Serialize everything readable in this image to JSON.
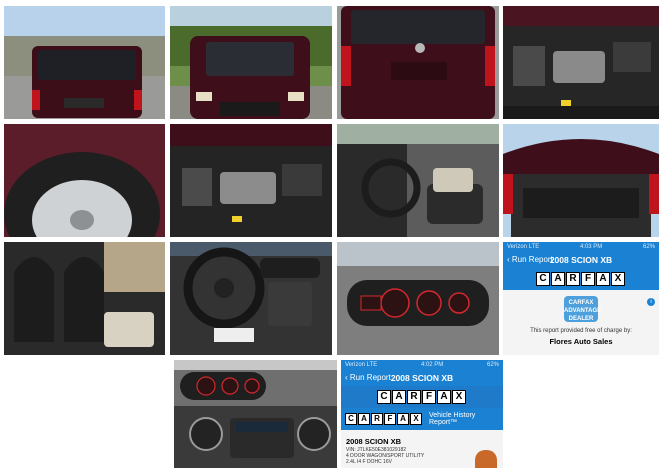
{
  "gallery": {
    "photos": [
      {
        "alt": "rear-view"
      },
      {
        "alt": "front-view"
      },
      {
        "alt": "rear-closeup"
      },
      {
        "alt": "engine-bay"
      },
      {
        "alt": "tire"
      },
      {
        "alt": "engine-bay-2"
      },
      {
        "alt": "driver-interior"
      },
      {
        "alt": "open-hatch"
      },
      {
        "alt": "rear-seats"
      },
      {
        "alt": "steering-wheel"
      },
      {
        "alt": "instrument-cluster"
      },
      {
        "alt": "center-console"
      }
    ]
  },
  "carfax_screen_1": {
    "status_left": "Verizon  LTE",
    "status_time": "4:03 PM",
    "status_right": "62%",
    "back_label": "Run Report",
    "title": "2008 SCION XB",
    "logo_letters": [
      "C",
      "A",
      "R",
      "F",
      "A",
      "X"
    ],
    "badge_text": "CARFAX ADVANTAGE DEALER",
    "provided_text": "This report provided free of charge by:",
    "dealer_name": "Flores Auto Sales",
    "info_icon": "i"
  },
  "carfax_screen_2": {
    "status_left": "Verizon  LTE",
    "status_time": "4:02 PM",
    "status_right": "62%",
    "back_label": "Run Report",
    "title": "2008 SCION XB",
    "logo_letters": [
      "C",
      "A",
      "R",
      "F",
      "A",
      "X"
    ],
    "vhr_label": "Vehicle History Report™",
    "model": "2008 SCION XB",
    "vin": "VIN: JTLKE50E381029182",
    "body": "4 DOOR WAGON/SPORT UTILITY",
    "engine": "2.4L I4 F DOHC 16V"
  },
  "colors": {
    "carfax_blue": "#1b82d3",
    "car_paint": "#4a1420"
  }
}
